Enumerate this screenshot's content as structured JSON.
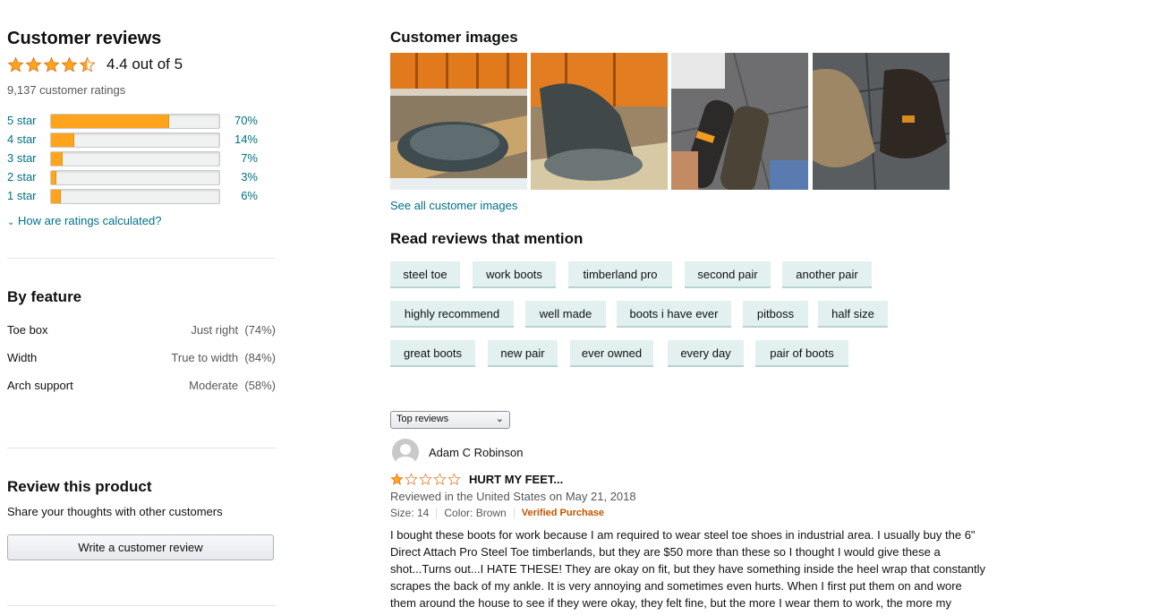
{
  "left": {
    "title": "Customer reviews",
    "rating_value": 4.4,
    "rating_text": "4.4 out of 5",
    "total_ratings": "9,137 customer ratings",
    "histogram": [
      {
        "label": "5 star",
        "pct_text": "70%",
        "pct": 70
      },
      {
        "label": "4 star",
        "pct_text": "14%",
        "pct": 14
      },
      {
        "label": "3 star",
        "pct_text": "7%",
        "pct": 7
      },
      {
        "label": "2 star",
        "pct_text": "3%",
        "pct": 3
      },
      {
        "label": "1 star",
        "pct_text": "6%",
        "pct": 6
      }
    ],
    "how_calculated": "How are ratings calculated?",
    "by_feature_title": "By feature",
    "features": [
      {
        "name": "Toe box",
        "value": "Just right",
        "pct": "(74%)"
      },
      {
        "name": "Width",
        "value": "True to width",
        "pct": "(84%)"
      },
      {
        "name": "Arch support",
        "value": "Moderate",
        "pct": "(58%)"
      }
    ],
    "review_product_title": "Review this product",
    "review_product_sub": "Share your thoughts with other customers",
    "write_review_label": "Write a customer review"
  },
  "right": {
    "customer_images_title": "Customer images",
    "see_all_images": "See all customer images",
    "mention_title": "Read reviews that mention",
    "chips": [
      [
        "steel toe",
        "work boots",
        "timberland pro",
        "second pair",
        "another pair"
      ],
      [
        "highly recommend",
        "well made",
        "boots i have ever",
        "pitboss",
        "half size"
      ],
      [
        "great boots",
        "new pair",
        "ever owned",
        "every day",
        "pair of boots"
      ]
    ],
    "sort_selected": "Top reviews",
    "review": {
      "author": "Adam C Robinson",
      "rating": 1,
      "title": "HURT MY FEET...",
      "meta": "Reviewed in the United States on May 21, 2018",
      "size": "Size: 14",
      "color": "Color: Brown",
      "verified": "Verified Purchase",
      "body_lines": [
        "I bought these boots for work because I am required to wear steel toe shoes in industrial area. I usually buy the 6\"",
        "Direct Attach Pro Steel Toe timberlands, but they are $50 more than these so I thought I would give these a",
        "shot...Turns out...I HATE THESE! They are okay on fit, but they have something inside the heel wrap that constantly",
        "scrapes the back of my ankle. It is very annoying and sometimes even hurts. When I first put them on and wore",
        "them around the house to see if they were okay, they felt fine, but the more I wear them to work, the more my"
      ]
    }
  },
  "colors": {
    "star": "#FFA41C",
    "link": "#007185",
    "verified": "#C45500",
    "chip_bg": "#e3f0f0"
  }
}
